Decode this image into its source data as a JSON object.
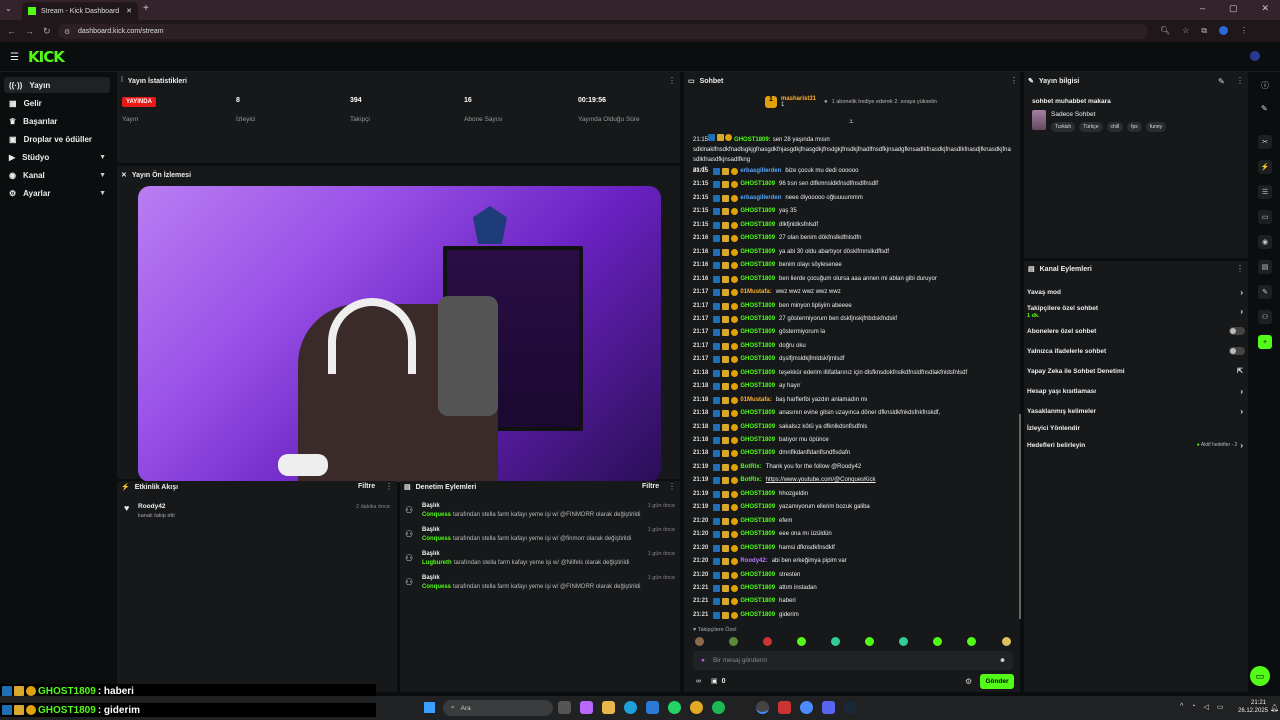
{
  "browser": {
    "tab_title": "Stream - Kick Dashboard",
    "url": "dashboard.kick.com/stream"
  },
  "brand": {
    "logo": "KICK",
    "accent": "#53fc18"
  },
  "sidebar": {
    "items": [
      {
        "label": "Yayın",
        "icon": "broadcast-icon",
        "selected": true
      },
      {
        "label": "Gelir",
        "icon": "money-icon"
      },
      {
        "label": "Başarılar",
        "icon": "trophy-icon"
      },
      {
        "label": "Droplar ve ödüller",
        "icon": "gift-icon"
      },
      {
        "label": "Stüdyo",
        "icon": "studio-icon",
        "expandable": true
      },
      {
        "label": "Kanal",
        "icon": "channel-icon",
        "expandable": true
      },
      {
        "label": "Ayarlar",
        "icon": "settings-icon",
        "expandable": true
      }
    ]
  },
  "stats": {
    "title": "Yayın İstatistikleri",
    "live_badge": "YAYINDA",
    "live_label": "Yayın",
    "viewers_value": "8",
    "viewers_label": "İzleyici",
    "followers_value": "394",
    "followers_label": "Takipçi",
    "subs_value": "16",
    "subs_label": "Abone Sayısı",
    "uptime_value": "00:19:56",
    "uptime_label": "Yayında Olduğu Süre"
  },
  "preview": {
    "title": "Yayın Ön İzlemesi"
  },
  "activity": {
    "title": "Etkinlik Akışı",
    "filter": "Filtre",
    "items": [
      {
        "name": "Roody42",
        "desc": "kanalı takip etti",
        "time": "2 dakika önce"
      }
    ]
  },
  "moderation": {
    "title": "Denetim Eylemleri",
    "filter": "Filtre",
    "items": [
      {
        "title": "Başlık",
        "actor": "Conquess",
        "text": "tarafından stella farm kafayı yeme işi w/ @FINMORR olarak değiştirildi",
        "time": "1 gün önce"
      },
      {
        "title": "Başlık",
        "actor": "Conquess",
        "text": "tarafından stella farm kafayı yeme işi w/ @finmorr olarak değiştirildi",
        "time": "1 gün önce"
      },
      {
        "title": "Başlık",
        "actor": "Lugbureth",
        "text": "tarafından stella farm kafayı yeme işi w/ @Nilfels olarak değiştirildi",
        "time": "1 gün önce"
      },
      {
        "title": "Başlık",
        "actor": "Conquess",
        "text": "tarafından stella farm kafayı yeme işi w/ @FINMORR olarak değiştirildi",
        "time": "1 gün önce"
      }
    ]
  },
  "chat": {
    "title": "Sohbet",
    "pinned_user": "masharist31",
    "pinned_count": "1",
    "pinned_note": "1 abonelik hediye ederek 2. sıraya yükselin",
    "top_text_1": "sen 28 yaşında mısın",
    "top_text_2": "sdklnaklfnsdkfnadlsgkjgfnasgdkfnjasgdkjfnasgdkjfnsdgkjfnsdkjfnadlfnsdfkjnsadgfknsadlkfnasdkjfnasdlkfnasdjfknasdkjfnasdlkfnasdfkjnsadlfkng",
    "top_text_3": "as.df",
    "follower_only": "Takipçilere Özel",
    "input_placeholder": "Bir mesaj gönderin",
    "send": "Gönder",
    "points": "0",
    "messages": [
      {
        "time": "21:15",
        "user": "erbasgillerden",
        "color": "blue",
        "text": "bize çocuk mu dedi oooooo"
      },
      {
        "time": "21:15",
        "user": "GHOST1809",
        "color": "green",
        "text": "96 tısn sen dlfkmnsldkfnsdlfnsdlfnsdlf"
      },
      {
        "time": "21:15",
        "user": "erbasgillerden",
        "color": "blue",
        "text": "neee diyooooo oğluuuummm"
      },
      {
        "time": "21:15",
        "user": "GHOST1809",
        "color": "green",
        "text": "yaş 35"
      },
      {
        "time": "21:15",
        "user": "GHOST1809",
        "color": "green",
        "text": "dlkfjnldksfnlsdf"
      },
      {
        "time": "21:16",
        "user": "GHOST1809",
        "color": "green",
        "text": "27 olan benim dökfnslkdfnlsdfn"
      },
      {
        "time": "21:16",
        "user": "GHOST1809",
        "color": "green",
        "text": "ya abi 30 oldu abartıyor dösklfmnslkdflsdf"
      },
      {
        "time": "21:16",
        "user": "GHOST1809",
        "color": "green",
        "text": "benim olayı söylesenee"
      },
      {
        "time": "21:16",
        "user": "GHOST1809",
        "color": "green",
        "text": "ben lierde çocuğum olursa aaa annen mi ablan gibi duruyor"
      },
      {
        "time": "21:17",
        "user": "01Mustafa:",
        "color": "orange",
        "text": "wwz wwz wwz wwz wwz"
      },
      {
        "time": "21:17",
        "user": "GHOST1809",
        "color": "green",
        "text": "ben minyon tipliyim abeeee"
      },
      {
        "time": "21:17",
        "user": "GHOST1809",
        "color": "green",
        "text": "27 göstermiyorum ben dskfjnskjfnbdskfndskf"
      },
      {
        "time": "21:17",
        "user": "GHOST1809",
        "color": "green",
        "text": "göstermiyorum la"
      },
      {
        "time": "21:17",
        "user": "GHOST1809",
        "color": "green",
        "text": "doğru oku"
      },
      {
        "time": "21:17",
        "user": "GHOST1809",
        "color": "green",
        "text": "dşslfjmsldkjfmldskfjmlsdf"
      },
      {
        "time": "21:18",
        "user": "GHOST1809",
        "color": "green",
        "text": "teşekkür ederim iltifatlarınız için dlsfknsdokfnslkdfnsldfnsdlakfnldsfnlsdf"
      },
      {
        "time": "21:18",
        "user": "GHOST1809",
        "color": "green",
        "text": "ay hayır"
      },
      {
        "time": "21:18",
        "user": "01Mustafa:",
        "color": "orange",
        "text": "baş harflerlbi yazdın anlamadın mı"
      },
      {
        "time": "21:18",
        "user": "GHOST1809",
        "color": "green",
        "text": "anasının evine gitsin uzayınca döner dfknsldkfnkdsfnkfnskdf,"
      },
      {
        "time": "21:18",
        "user": "GHOST1809",
        "color": "green",
        "text": "sakalsız kötü ya dfknlkdsnflsdfnls"
      },
      {
        "time": "21:18",
        "user": "GHOST1809",
        "color": "green",
        "text": "batıyor mu öpünce"
      },
      {
        "time": "21:18",
        "user": "GHOST1809",
        "color": "green",
        "text": "dmnflkdanfldanflsndflsdafn"
      },
      {
        "time": "21:19",
        "user": "BotRix:",
        "color": "green",
        "text": "Thank you for the follow @Roody42"
      },
      {
        "time": "21:19",
        "user": "BotRix:",
        "color": "green",
        "text": "https://www.youtube.com/@ConquesKick"
      },
      {
        "time": "21:19",
        "user": "GHOST1809",
        "color": "green",
        "text": "hhozgeldin"
      },
      {
        "time": "21:19",
        "user": "GHOST1809",
        "color": "green",
        "text": "yazamıyorum ellerim bozuk galiba"
      },
      {
        "time": "21:20",
        "user": "GHOST1809",
        "color": "green",
        "text": "efem"
      },
      {
        "time": "21:20",
        "user": "GHOST1809",
        "color": "green",
        "text": "eee ona mı üzüldün"
      },
      {
        "time": "21:20",
        "user": "GHOST1809",
        "color": "green",
        "text": "hamsi dfknsdkfnsdklf"
      },
      {
        "time": "21:20",
        "user": "Roody42:",
        "color": "purple",
        "text": "abi ben erkeğimya pipim var"
      },
      {
        "time": "21:20",
        "user": "GHOST1809",
        "color": "green",
        "text": "stresten"
      },
      {
        "time": "21:21",
        "user": "GHOST1809",
        "color": "green",
        "text": "attım instadan"
      },
      {
        "time": "21:21",
        "user": "GHOST1809",
        "color": "green",
        "text": "haberi"
      },
      {
        "time": "21:21",
        "user": "GHOST1809",
        "color": "green",
        "text": "giderim"
      }
    ]
  },
  "stream_info": {
    "title": "Yayın bilgisi",
    "stream_title": "sohbet muhabbet makara",
    "category": "Sadece Sohbet",
    "tags": [
      "Turkish",
      "Türkçe",
      "chill",
      "fps",
      "funny"
    ]
  },
  "channel_actions": {
    "title": "Kanal Eylemleri",
    "items": [
      {
        "label": "Yavaş mod",
        "type": "arrow"
      },
      {
        "label": "Takipçilere özel sohbet",
        "sub": "1 dk.",
        "type": "arrow"
      },
      {
        "label": "Abonelere özel sohbet",
        "type": "toggle"
      },
      {
        "label": "Yalnızca ifadelerle sohbet",
        "type": "toggle"
      },
      {
        "label": "Yapay Zeka ile Sohbet Denetimi",
        "type": "external"
      },
      {
        "label": "Hesap yaşı kısıtlaması",
        "type": "arrow"
      },
      {
        "label": "Yasaklanmış kelimeler",
        "type": "arrow"
      },
      {
        "label": "İzleyici Yönlendir",
        "type": "none"
      },
      {
        "label": "Hedefleri belirleyin",
        "status": "Aktif hedefler - 2",
        "type": "arrow"
      }
    ]
  },
  "overlay": [
    {
      "user": "GHOST1809",
      "text": ": haberi"
    },
    {
      "user": "GHOST1809",
      "text": ": giderim"
    }
  ],
  "taskbar": {
    "search": "Ara",
    "time": "21:21",
    "date": "26.12.2025"
  }
}
